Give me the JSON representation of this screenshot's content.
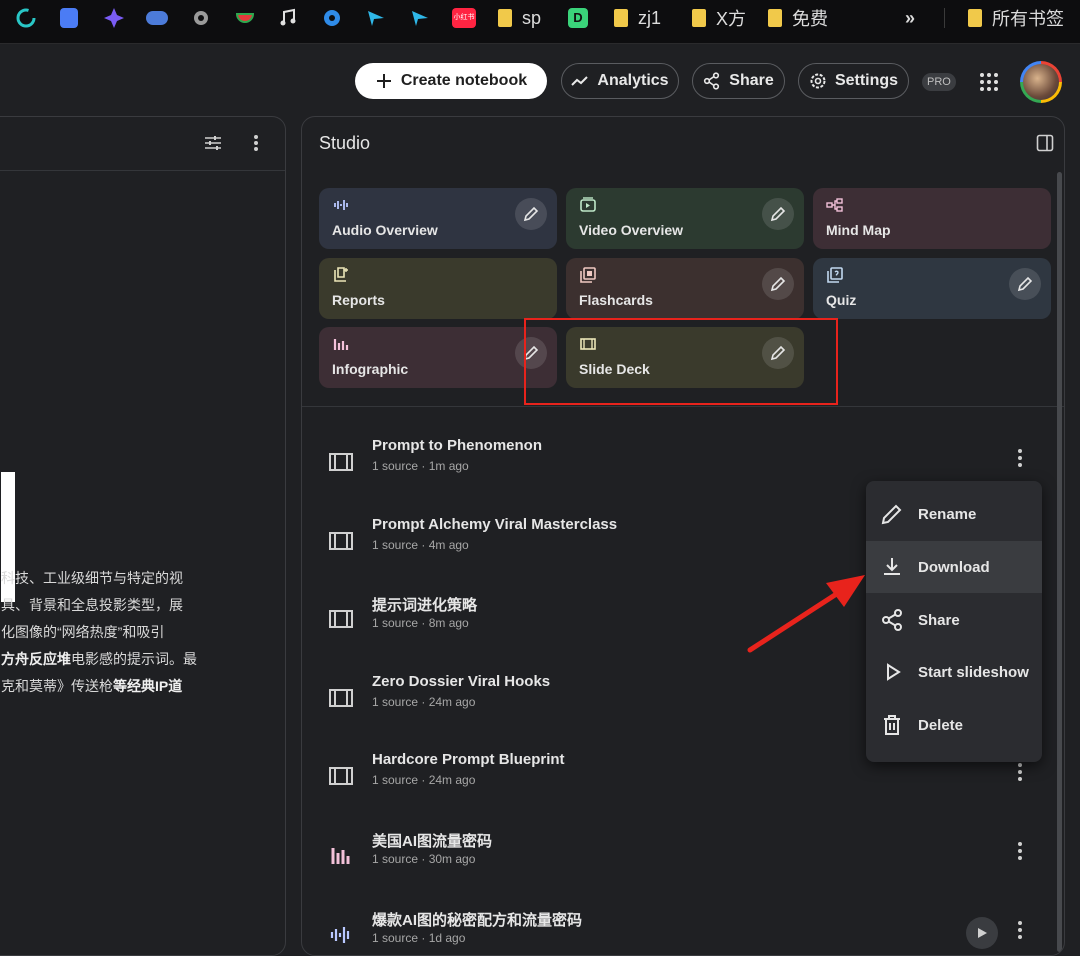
{
  "bookmarks": [
    {
      "icon": "refresh-circle-icon",
      "label": ""
    },
    {
      "icon": "docs-icon",
      "label": ""
    },
    {
      "icon": "sparkle-icon",
      "label": ""
    },
    {
      "icon": "whale-icon",
      "label": ""
    },
    {
      "icon": "gear-icon",
      "label": ""
    },
    {
      "icon": "watermelon-icon",
      "label": ""
    },
    {
      "icon": "music-note-icon",
      "label": ""
    },
    {
      "icon": "gear-blue-icon",
      "label": ""
    },
    {
      "icon": "arrow-icon",
      "label": ""
    },
    {
      "icon": "arrow-icon",
      "label": ""
    },
    {
      "icon": "xiaohongshu-icon",
      "label": "小红书"
    },
    {
      "icon": "folder-icon",
      "label": "sp"
    },
    {
      "icon": "d-icon",
      "label": "D"
    },
    {
      "icon": "folder-icon",
      "label": "zj1"
    },
    {
      "icon": "folder-icon",
      "label": "X方"
    },
    {
      "icon": "folder-icon",
      "label": "免费"
    },
    {
      "icon": "chevron-double-right-icon",
      "label": "»"
    },
    {
      "icon": "folder-icon",
      "label": "所有书签"
    }
  ],
  "header": {
    "create_label": "Create notebook",
    "analytics_label": "Analytics",
    "share_label": "Share",
    "settings_label": "Settings",
    "pro_badge": "PRO"
  },
  "left_panel": {
    "lines": [
      {
        "text": "科技、工业级细节与特定的视",
        "bold": false
      },
      {
        "text": "具、背景和全息投影类型，展",
        "bold": false
      },
      {
        "text": "化图像的“网络热度”和吸引",
        "bold": false
      },
      {
        "text": "方舟反应堆电影感的提示词。最",
        "bold_prefix": "方舟反应堆",
        "rest": "电影感的提示词。最"
      },
      {
        "text": "克和莫蒂》传送枪等经典IP道",
        "bold_suffix": "等经典IP道",
        "rest": "克和莫蒂》传送枪"
      }
    ]
  },
  "studio": {
    "title": "Studio",
    "tiles": [
      {
        "label": "Audio Overview",
        "icon": "audio-waveform-icon",
        "color": "#2f3441"
      },
      {
        "label": "Video Overview",
        "icon": "video-icon",
        "color": "#2c3a30"
      },
      {
        "label": "Mind Map",
        "icon": "mind-map-icon",
        "color": "#3d2e35"
      },
      {
        "label": "Reports",
        "icon": "report-icon",
        "color": "#3a3a2c"
      },
      {
        "label": "Flashcards",
        "icon": "flashcards-icon",
        "color": "#3c302f"
      },
      {
        "label": "Quiz",
        "icon": "quiz-icon",
        "color": "#2f3741"
      },
      {
        "label": "Infographic",
        "icon": "infographic-icon",
        "color": "#3d2e35"
      },
      {
        "label": "Slide Deck",
        "icon": "slide-deck-icon",
        "color": "#3a3a2c"
      }
    ],
    "items": [
      {
        "title": "Prompt to Phenomenon",
        "meta": "1 source · 1m ago",
        "icon": "slide-deck-icon"
      },
      {
        "title": "Prompt Alchemy Viral Masterclass",
        "meta": "1 source · 4m ago",
        "icon": "slide-deck-icon"
      },
      {
        "title": "提示词进化策略",
        "meta": "1 source · 8m ago",
        "icon": "slide-deck-icon"
      },
      {
        "title": "Zero Dossier Viral Hooks",
        "meta": "1 source · 24m ago",
        "icon": "slide-deck-icon"
      },
      {
        "title": "Hardcore Prompt Blueprint",
        "meta": "1 source · 24m ago",
        "icon": "slide-deck-icon"
      },
      {
        "title": "美国AI图流量密码",
        "meta": "1 source · 30m ago",
        "icon": "infographic-icon"
      },
      {
        "title": "爆款AI图的秘密配方和流量密码",
        "meta": "1 source · 1d ago",
        "icon": "audio-waveform-icon"
      }
    ]
  },
  "menu": {
    "items": [
      {
        "label": "Rename",
        "icon": "pencil-icon"
      },
      {
        "label": "Download",
        "icon": "download-icon"
      },
      {
        "label": "Share",
        "icon": "share-icon"
      },
      {
        "label": "Start slideshow",
        "icon": "play-icon"
      },
      {
        "label": "Delete",
        "icon": "trash-icon"
      }
    ]
  },
  "colors": {
    "highlight": "#e8231c",
    "accent_white": "#ffffff"
  }
}
